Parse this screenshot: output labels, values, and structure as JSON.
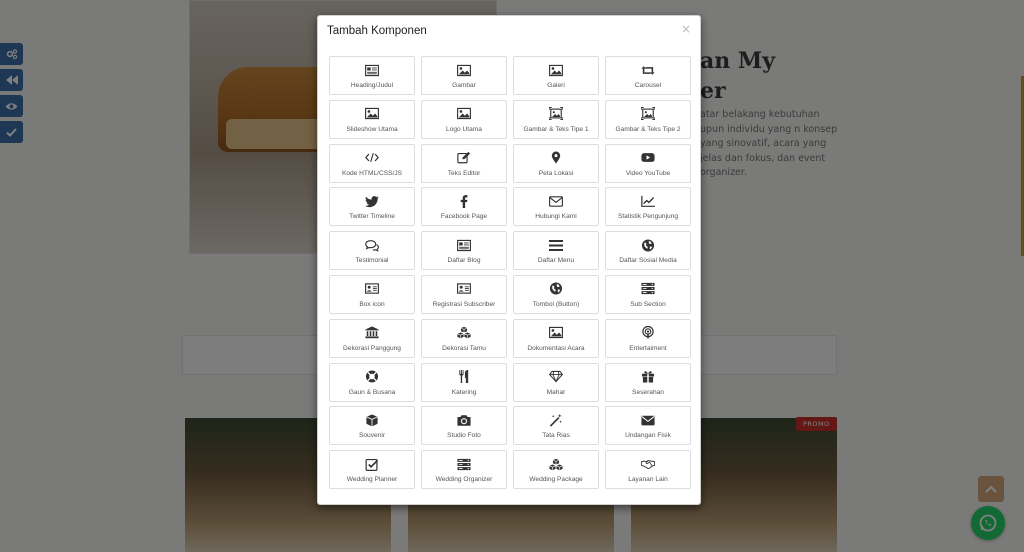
{
  "background": {
    "hero_title_line1": "an My",
    "hero_title_line2": "er",
    "hero_paragraph": "atar belakang kebutuhan upun individu yang n konsep yang sinovatif, acara yang jelas dan fokus, dan event organizer.",
    "promo_badge": "PROMO"
  },
  "modal": {
    "title": "Tambah Komponen",
    "close_label": "×",
    "components": [
      {
        "label": "Heading/Judul",
        "icon": "newspaper-icon"
      },
      {
        "label": "Gambar",
        "icon": "image-icon"
      },
      {
        "label": "Galeri",
        "icon": "image-icon"
      },
      {
        "label": "Carousel",
        "icon": "retweet-icon"
      },
      {
        "label": "Slideshow Utama",
        "icon": "image-icon"
      },
      {
        "label": "Logo Utama",
        "icon": "image-icon"
      },
      {
        "label": "Gambar & Teks Tipe 1",
        "icon": "framed-image-icon"
      },
      {
        "label": "Gambar & Teks Tipe 2",
        "icon": "framed-image-icon"
      },
      {
        "label": "Kode HTML/CSS/JS",
        "icon": "code-icon"
      },
      {
        "label": "Teks Editor",
        "icon": "edit-icon"
      },
      {
        "label": "Peta Lokasi",
        "icon": "map-marker-icon"
      },
      {
        "label": "Video YouTube",
        "icon": "youtube-icon"
      },
      {
        "label": "Twitter Timeline",
        "icon": "twitter-icon"
      },
      {
        "label": "Facebook Page",
        "icon": "facebook-icon"
      },
      {
        "label": "Hubungi Kami",
        "icon": "envelope-icon"
      },
      {
        "label": "Statistik Pengunjung",
        "icon": "line-chart-icon"
      },
      {
        "label": "Testimonial",
        "icon": "comments-icon"
      },
      {
        "label": "Daftar Blog",
        "icon": "newspaper-icon"
      },
      {
        "label": "Daftar Menu",
        "icon": "bars-icon"
      },
      {
        "label": "Daftar Sosial Media",
        "icon": "globe-icon"
      },
      {
        "label": "Box icon",
        "icon": "id-card-icon"
      },
      {
        "label": "Registrasi Subscriber",
        "icon": "id-card-icon"
      },
      {
        "label": "Tombol (Button)",
        "icon": "globe-icon"
      },
      {
        "label": "Sub Section",
        "icon": "server-icon"
      },
      {
        "label": "Dekorasi Panggung",
        "icon": "institution-icon"
      },
      {
        "label": "Dekorasi Tamu",
        "icon": "cubes-icon"
      },
      {
        "label": "Dokumentasi Acara",
        "icon": "image-icon"
      },
      {
        "label": "Entertaiment",
        "icon": "podcast-icon"
      },
      {
        "label": "Gaun & Busana",
        "icon": "life-ring-icon"
      },
      {
        "label": "Katering",
        "icon": "utensils-icon"
      },
      {
        "label": "Mahar",
        "icon": "diamond-icon"
      },
      {
        "label": "Seserahan",
        "icon": "gift-icon"
      },
      {
        "label": "Souvenir",
        "icon": "cube-icon"
      },
      {
        "label": "Studio Foto",
        "icon": "camera-icon"
      },
      {
        "label": "Tata Rias",
        "icon": "magic-wand-icon"
      },
      {
        "label": "Undangan Fisik",
        "icon": "envelope-filled-icon"
      },
      {
        "label": "Wedding Planner",
        "icon": "check-square-icon"
      },
      {
        "label": "Wedding Organizer",
        "icon": "server-icon"
      },
      {
        "label": "Wedding Package",
        "icon": "cubes-icon"
      },
      {
        "label": "Layanan Lain",
        "icon": "handshake-icon"
      }
    ]
  },
  "sidebar_tools": [
    "settings-icon",
    "rewind-icon",
    "eye-icon",
    "check-icon"
  ],
  "colors": {
    "side_tool_bg": "#3a6ea8",
    "scroll_top_bg": "#d2a679",
    "whatsapp_bg": "#25d366",
    "promo_bg": "#c9302c"
  }
}
